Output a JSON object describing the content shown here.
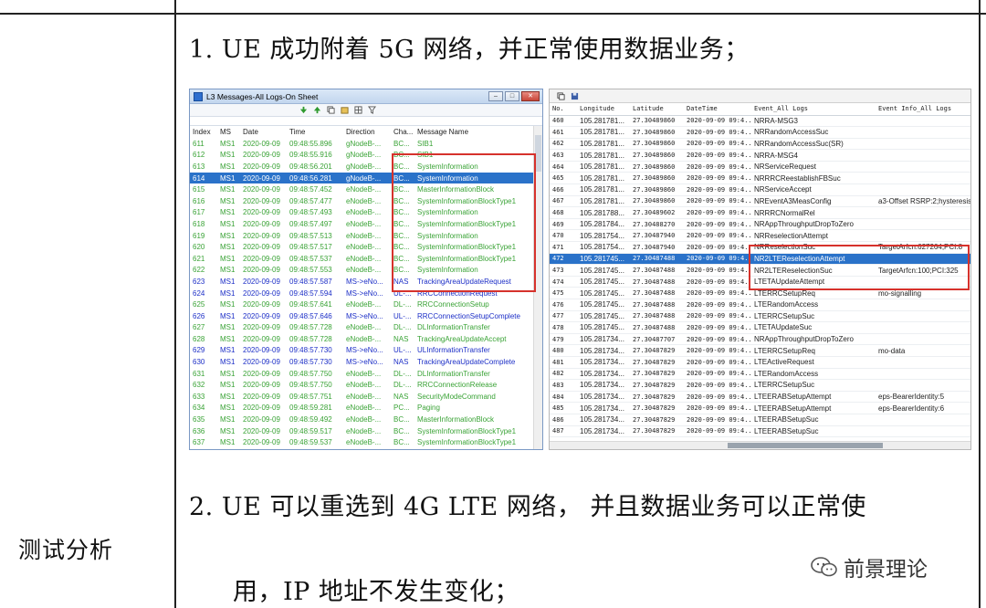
{
  "doc": {
    "cell_label": "测试分析",
    "line1": "1.  UE 成功附着 5G 网络，并正常使用数据业务；",
    "line2": "2.  UE 可以重选到 4G LTE 网络， 并且数据业务可以正常使",
    "line3": "用，IP 地址不发生变化；",
    "watermark": "前景理论",
    "wechat_icon": "wechat-icon"
  },
  "left_window": {
    "title": "L3 Messages-All Logs-On Sheet",
    "columns": [
      "Index",
      "MS",
      "Date",
      "Time",
      "Direction",
      "Cha...",
      "Message Name"
    ],
    "rows": [
      {
        "index": "611",
        "ms": "MS1",
        "date": "2020-09-09",
        "time": "09:48:55.896",
        "dir": "gNodeB-...",
        "cha": "BC...",
        "msg": "SIB1",
        "type": "down"
      },
      {
        "index": "612",
        "ms": "MS1",
        "date": "2020-09-09",
        "time": "09:48:55.916",
        "dir": "gNodeB-...",
        "cha": "BC...",
        "msg": "SIB1",
        "type": "down"
      },
      {
        "index": "613",
        "ms": "MS1",
        "date": "2020-09-09",
        "time": "09:48:56.201",
        "dir": "gNodeB-...",
        "cha": "BC...",
        "msg": "SystemInformation",
        "type": "down"
      },
      {
        "index": "614",
        "ms": "MS1",
        "date": "2020-09-09",
        "time": "09:48:56.281",
        "dir": "gNodeB-...",
        "cha": "BC...",
        "msg": "SystemInformation",
        "type": "sel"
      },
      {
        "index": "615",
        "ms": "MS1",
        "date": "2020-09-09",
        "time": "09:48:57.452",
        "dir": "eNodeB-...",
        "cha": "BC...",
        "msg": "MasterInformationBlock",
        "type": "down"
      },
      {
        "index": "616",
        "ms": "MS1",
        "date": "2020-09-09",
        "time": "09:48:57.477",
        "dir": "eNodeB-...",
        "cha": "BC...",
        "msg": "SystemInformationBlockType1",
        "type": "down"
      },
      {
        "index": "617",
        "ms": "MS1",
        "date": "2020-09-09",
        "time": "09:48:57.493",
        "dir": "eNodeB-...",
        "cha": "BC...",
        "msg": "SystemInformation",
        "type": "down"
      },
      {
        "index": "618",
        "ms": "MS1",
        "date": "2020-09-09",
        "time": "09:48:57.497",
        "dir": "eNodeB-...",
        "cha": "BC...",
        "msg": "SystemInformationBlockType1",
        "type": "down"
      },
      {
        "index": "619",
        "ms": "MS1",
        "date": "2020-09-09",
        "time": "09:48:57.513",
        "dir": "eNodeB-...",
        "cha": "BC...",
        "msg": "SystemInformation",
        "type": "down"
      },
      {
        "index": "620",
        "ms": "MS1",
        "date": "2020-09-09",
        "time": "09:48:57.517",
        "dir": "eNodeB-...",
        "cha": "BC...",
        "msg": "SystemInformationBlockType1",
        "type": "down"
      },
      {
        "index": "621",
        "ms": "MS1",
        "date": "2020-09-09",
        "time": "09:48:57.537",
        "dir": "eNodeB-...",
        "cha": "BC...",
        "msg": "SystemInformationBlockType1",
        "type": "down"
      },
      {
        "index": "622",
        "ms": "MS1",
        "date": "2020-09-09",
        "time": "09:48:57.553",
        "dir": "eNodeB-...",
        "cha": "BC...",
        "msg": "SystemInformation",
        "type": "down"
      },
      {
        "index": "623",
        "ms": "MS1",
        "date": "2020-09-09",
        "time": "09:48:57.587",
        "dir": "MS->eNo...",
        "cha": "NAS",
        "msg": "TrackingAreaUpdateRequest",
        "type": "up"
      },
      {
        "index": "624",
        "ms": "MS1",
        "date": "2020-09-09",
        "time": "09:48:57.594",
        "dir": "MS->eNo...",
        "cha": "UL-...",
        "msg": "RRCConnectionRequest",
        "type": "up"
      },
      {
        "index": "625",
        "ms": "MS1",
        "date": "2020-09-09",
        "time": "09:48:57.641",
        "dir": "eNodeB-...",
        "cha": "DL-...",
        "msg": "RRCConnectionSetup",
        "type": "down"
      },
      {
        "index": "626",
        "ms": "MS1",
        "date": "2020-09-09",
        "time": "09:48:57.646",
        "dir": "MS->eNo...",
        "cha": "UL-...",
        "msg": "RRCConnectionSetupComplete",
        "type": "up"
      },
      {
        "index": "627",
        "ms": "MS1",
        "date": "2020-09-09",
        "time": "09:48:57.728",
        "dir": "eNodeB-...",
        "cha": "DL-...",
        "msg": "DLInformationTransfer",
        "type": "down"
      },
      {
        "index": "628",
        "ms": "MS1",
        "date": "2020-09-09",
        "time": "09:48:57.728",
        "dir": "eNodeB-...",
        "cha": "NAS",
        "msg": "TrackingAreaUpdateAccept",
        "type": "down"
      },
      {
        "index": "629",
        "ms": "MS1",
        "date": "2020-09-09",
        "time": "09:48:57.730",
        "dir": "MS->eNo...",
        "cha": "UL-...",
        "msg": "ULInformationTransfer",
        "type": "up"
      },
      {
        "index": "630",
        "ms": "MS1",
        "date": "2020-09-09",
        "time": "09:48:57.730",
        "dir": "MS->eNo...",
        "cha": "NAS",
        "msg": "TrackingAreaUpdateComplete",
        "type": "up"
      },
      {
        "index": "631",
        "ms": "MS1",
        "date": "2020-09-09",
        "time": "09:48:57.750",
        "dir": "eNodeB-...",
        "cha": "DL-...",
        "msg": "DLInformationTransfer",
        "type": "down"
      },
      {
        "index": "632",
        "ms": "MS1",
        "date": "2020-09-09",
        "time": "09:48:57.750",
        "dir": "eNodeB-...",
        "cha": "DL-...",
        "msg": "RRCConnectionRelease",
        "type": "down"
      },
      {
        "index": "633",
        "ms": "MS1",
        "date": "2020-09-09",
        "time": "09:48:57.751",
        "dir": "eNodeB-...",
        "cha": "NAS",
        "msg": "SecurityModeCommand",
        "type": "down"
      },
      {
        "index": "634",
        "ms": "MS1",
        "date": "2020-09-09",
        "time": "09:48:59.281",
        "dir": "eNodeB-...",
        "cha": "PC...",
        "msg": "Paging",
        "type": "down"
      },
      {
        "index": "635",
        "ms": "MS1",
        "date": "2020-09-09",
        "time": "09:48:59.492",
        "dir": "eNodeB-...",
        "cha": "BC...",
        "msg": "MasterInformationBlock",
        "type": "down"
      },
      {
        "index": "636",
        "ms": "MS1",
        "date": "2020-09-09",
        "time": "09:48:59.517",
        "dir": "eNodeB-...",
        "cha": "BC...",
        "msg": "SystemInformationBlockType1",
        "type": "down"
      },
      {
        "index": "637",
        "ms": "MS1",
        "date": "2020-09-09",
        "time": "09:48:59.537",
        "dir": "eNodeB-...",
        "cha": "BC...",
        "msg": "SystemInformationBlockType1",
        "type": "down"
      }
    ]
  },
  "right_window": {
    "columns": [
      "No.",
      "Longitude",
      "Latitude",
      "DateTime",
      "Event_All Logs",
      "Event Info_All Logs"
    ],
    "rows": [
      {
        "no": "460",
        "lon": "105.281781...",
        "lat": "27.30489860",
        "dt": "2020-09-09 09:4...",
        "ev": "NRRA-MSG3",
        "info": ""
      },
      {
        "no": "461",
        "lon": "105.281781...",
        "lat": "27.30489860",
        "dt": "2020-09-09 09:4...",
        "ev": "NRRandomAccessSuc",
        "info": ""
      },
      {
        "no": "462",
        "lon": "105.281781...",
        "lat": "27.30489860",
        "dt": "2020-09-09 09:4...",
        "ev": "NRRandomAccessSuc(SR)",
        "info": ""
      },
      {
        "no": "463",
        "lon": "105.281781...",
        "lat": "27.30489860",
        "dt": "2020-09-09 09:4...",
        "ev": "NRRA-MSG4",
        "info": ""
      },
      {
        "no": "464",
        "lon": "105.281781...",
        "lat": "27.30489860",
        "dt": "2020-09-09 09:4...",
        "ev": "NRServiceRequest",
        "info": ""
      },
      {
        "no": "465",
        "lon": "105.281781...",
        "lat": "27.30489860",
        "dt": "2020-09-09 09:4...",
        "ev": "NRRRCReestablishFBSuc",
        "info": ""
      },
      {
        "no": "466",
        "lon": "105.281781...",
        "lat": "27.30489860",
        "dt": "2020-09-09 09:4...",
        "ev": "NRServiceAccept",
        "info": ""
      },
      {
        "no": "467",
        "lon": "105.281781...",
        "lat": "27.30489860",
        "dt": "2020-09-09 09:4...",
        "ev": "NREventA3MeasConfig",
        "info": "a3-Offset RSRP:2;hysteresis"
      },
      {
        "no": "468",
        "lon": "105.281788...",
        "lat": "27.30489602",
        "dt": "2020-09-09 09:4...",
        "ev": "NRRRCNormalRel",
        "info": ""
      },
      {
        "no": "469",
        "lon": "105.281784...",
        "lat": "27.30488270",
        "dt": "2020-09-09 09:4...",
        "ev": "NRAppThroughputDropToZero",
        "info": ""
      },
      {
        "no": "470",
        "lon": "105.281754...",
        "lat": "27.30487940",
        "dt": "2020-09-09 09:4...",
        "ev": "NRReselectionAttempt",
        "info": ""
      },
      {
        "no": "471",
        "lon": "105.281754...",
        "lat": "27.30487940",
        "dt": "2020-09-09 09:4...",
        "ev": "NRReselectionSuc",
        "info": "TargetArfcn:627264;PCI:8"
      },
      {
        "no": "472",
        "lon": "105.281745...",
        "lat": "27.30487488",
        "dt": "2020-09-09 09:4...",
        "ev": "NR2LTEReselectionAttempt",
        "info": "",
        "sel": true
      },
      {
        "no": "473",
        "lon": "105.281745...",
        "lat": "27.30487488",
        "dt": "2020-09-09 09:4...",
        "ev": "NR2LTEReselectionSuc",
        "info": "TargetArfcn:100;PCI:325"
      },
      {
        "no": "474",
        "lon": "105.281745...",
        "lat": "27.30487488",
        "dt": "2020-09-09 09:4...",
        "ev": "LTETAUpdateAttempt",
        "info": ""
      },
      {
        "no": "475",
        "lon": "105.281745...",
        "lat": "27.30487488",
        "dt": "2020-09-09 09:4...",
        "ev": "LTERRCSetupReq",
        "info": "mo-signalling"
      },
      {
        "no": "476",
        "lon": "105.281745...",
        "lat": "27.30487488",
        "dt": "2020-09-09 09:4...",
        "ev": "LTERandomAccess",
        "info": ""
      },
      {
        "no": "477",
        "lon": "105.281745...",
        "lat": "27.30487488",
        "dt": "2020-09-09 09:4...",
        "ev": "LTERRCSetupSuc",
        "info": ""
      },
      {
        "no": "478",
        "lon": "105.281745...",
        "lat": "27.30487488",
        "dt": "2020-09-09 09:4...",
        "ev": "LTETAUpdateSuc",
        "info": ""
      },
      {
        "no": "479",
        "lon": "105.281734...",
        "lat": "27.30487707",
        "dt": "2020-09-09 09:4...",
        "ev": "NRAppThroughputDropToZero",
        "info": ""
      },
      {
        "no": "480",
        "lon": "105.281734...",
        "lat": "27.30487829",
        "dt": "2020-09-09 09:4...",
        "ev": "LTERRCSetupReq",
        "info": "mo-data"
      },
      {
        "no": "481",
        "lon": "105.281734...",
        "lat": "27.30487829",
        "dt": "2020-09-09 09:4...",
        "ev": "LTEActiveRequest",
        "info": ""
      },
      {
        "no": "482",
        "lon": "105.281734...",
        "lat": "27.30487829",
        "dt": "2020-09-09 09:4...",
        "ev": "LTERandomAccess",
        "info": ""
      },
      {
        "no": "483",
        "lon": "105.281734...",
        "lat": "27.30487829",
        "dt": "2020-09-09 09:4...",
        "ev": "LTERRCSetupSuc",
        "info": ""
      },
      {
        "no": "484",
        "lon": "105.281734...",
        "lat": "27.30487829",
        "dt": "2020-09-09 09:4...",
        "ev": "LTEERABSetupAttempt",
        "info": "eps-BearerIdentity:5"
      },
      {
        "no": "485",
        "lon": "105.281734...",
        "lat": "27.30487829",
        "dt": "2020-09-09 09:4...",
        "ev": "LTEERABSetupAttempt",
        "info": "eps-BearerIdentity:6"
      },
      {
        "no": "486",
        "lon": "105.281734...",
        "lat": "27.30487829",
        "dt": "2020-09-09 09:4...",
        "ev": "LTEERABSetupSuc",
        "info": ""
      },
      {
        "no": "487",
        "lon": "105.281734...",
        "lat": "27.30487829",
        "dt": "2020-09-09 09:4...",
        "ev": "LTEERABSetupSuc",
        "info": ""
      }
    ]
  },
  "colors": {
    "downlink_text": "#3aa336",
    "uplink_text": "#1d2fc7",
    "selection": "#2a72c9",
    "highlight_box": "#d6322c"
  }
}
